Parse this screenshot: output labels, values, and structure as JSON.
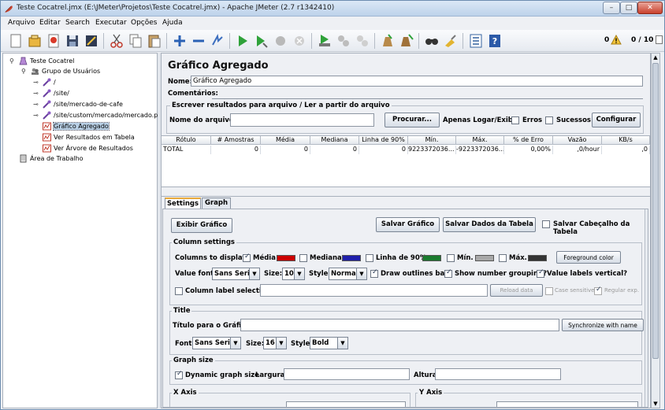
{
  "window": {
    "title": "Teste Cocatrel.jmx (E:\\JMeter\\Projetos\\Teste Cocatrel.jmx) - Apache JMeter (2.7 r1342410)",
    "min_label": "–",
    "max_label": "□",
    "close_label": "✕"
  },
  "menu": [
    {
      "label": "Arquivo"
    },
    {
      "label": "Editar"
    },
    {
      "label": "Search"
    },
    {
      "label": "Executar"
    },
    {
      "label": "Opções"
    },
    {
      "label": "Ajuda"
    }
  ],
  "toolbar": {
    "warnings_count": "0",
    "threads": "0 / 10"
  },
  "tree": {
    "items": [
      {
        "label": "Teste Cocatrel",
        "icon": "test-plan-icon"
      },
      {
        "label": "Grupo de Usuários",
        "icon": "thread-group-icon"
      },
      {
        "label": "/",
        "icon": "http-sampler-icon"
      },
      {
        "label": "/site/",
        "icon": "http-sampler-icon"
      },
      {
        "label": "/site/mercado-de-cafe",
        "icon": "http-sampler-icon"
      },
      {
        "label": "/site/custom/mercado/mercado.php",
        "icon": "http-sampler-icon"
      },
      {
        "label": "Gráfico Agregado",
        "icon": "listener-icon"
      },
      {
        "label": "Ver Resultados em Tabela",
        "icon": "listener-icon"
      },
      {
        "label": "Ver Árvore de Resultados",
        "icon": "listener-icon"
      },
      {
        "label": "Área de Trabalho",
        "icon": "workbench-icon"
      }
    ]
  },
  "panel": {
    "title": "Gráfico Agregado",
    "name_label": "Nome:",
    "name_value": "Gráfico Agregado",
    "comments_label": "Comentários:",
    "file_group_title": "Escrever resultados para arquivo / Ler a partir do arquivo",
    "filename_label": "Nome do arquivo",
    "filename_value": "",
    "browse_button": "Procurar...",
    "log_only_label": "Apenas Logar/Exibir",
    "errors_label": "Erros",
    "success_label": "Sucessos",
    "configure_button": "Configurar"
  },
  "table": {
    "headers": [
      "Rótulo",
      "# Amostras",
      "Média",
      "Mediana",
      "Linha de 90%",
      "Mín.",
      "Máx.",
      "% de Erro",
      "Vazão",
      "KB/s"
    ],
    "rows": [
      [
        "TOTAL",
        "0",
        "0",
        "0",
        "0",
        "9223372036...",
        "-9223372036...",
        "0,00%",
        ",0/hour",
        ",0"
      ]
    ]
  },
  "tabs": [
    {
      "label": "Settings",
      "active": true
    },
    {
      "label": "Graph",
      "active": false
    }
  ],
  "settings": {
    "show_graph_button": "Exibir Gráfico",
    "save_graph_button": "Salvar Gráfico",
    "save_table_button": "Salvar Dados da Tabela",
    "save_header_label": "Salvar Cabeçalho da Tabela",
    "column_settings_title": "Column settings",
    "columns_to_display_label": "Columns to display:",
    "columns": [
      {
        "label": "Média",
        "checked": true,
        "color": "#cc0000"
      },
      {
        "label": "Mediana",
        "checked": false,
        "color": "#1f1faa"
      },
      {
        "label": "Linha de 90%",
        "checked": false,
        "color": "#1a7a2e"
      },
      {
        "label": "Mín.",
        "checked": false,
        "color": "#a8a8a8"
      },
      {
        "label": "Máx.",
        "checked": false,
        "color": "#333333"
      }
    ],
    "foreground_button": "Foreground color",
    "value_font_label": "Value font:",
    "value_font": "Sans Serif",
    "size_label": "Size:",
    "size_value": "10",
    "style_label": "Style:",
    "style_value": "Normal",
    "draw_outlines_label": "Draw outlines bar?",
    "number_grouping_label": "Show number grouping?",
    "value_labels_label": "Value labels vertical?",
    "column_label_selection_label": "Column label selection:",
    "reload_button": "Reload data",
    "case_sensitive_label": "Case sensitive",
    "regex_label": "Regular exp.",
    "title_group_title": "Title",
    "graph_title_label": "Título para o Gráfico",
    "sync_button": "Synchronize with name",
    "font_label": "Font:",
    "title_font": "Sans Serif",
    "title_size_label": "Size:",
    "title_size": "16",
    "title_style_label": "Style:",
    "title_style": "Bold",
    "graph_size_title": "Graph size",
    "dynamic_size_label": "Dynamic graph size",
    "width_label": "Largura",
    "height_label": "Altura",
    "x_axis_title": "X Axis",
    "y_axis_title": "Y Axis"
  }
}
